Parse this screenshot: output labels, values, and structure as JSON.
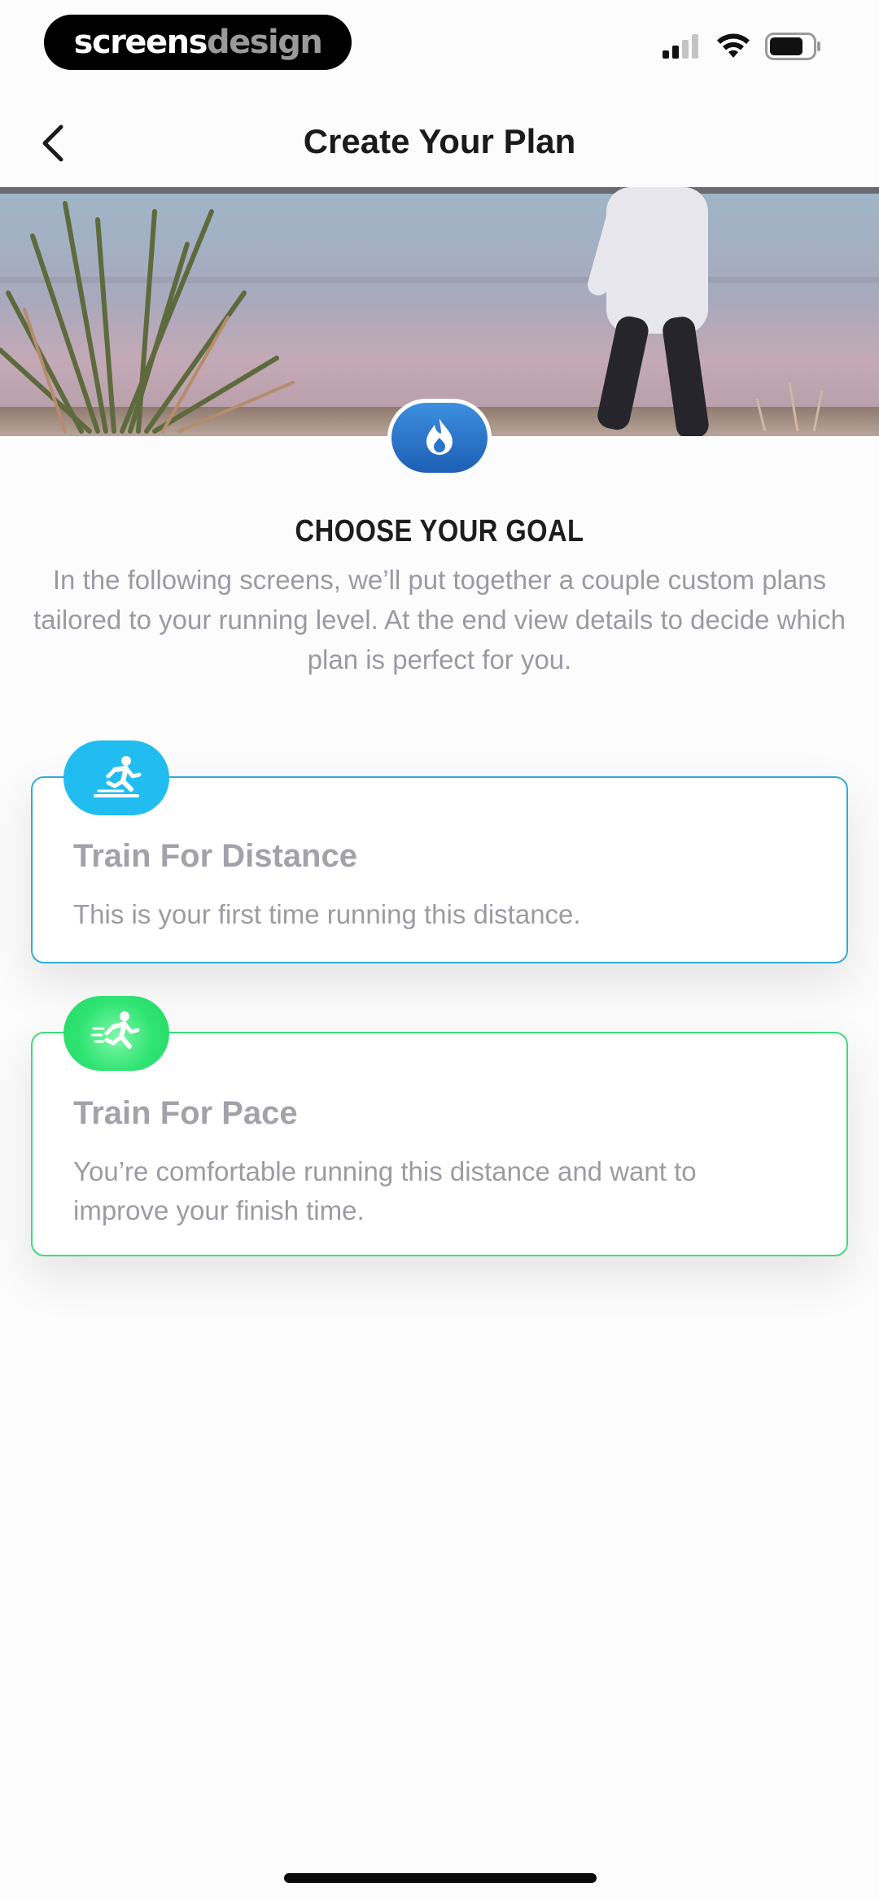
{
  "status_bar": {
    "brand_part1": "screens",
    "brand_part2": "design",
    "signal_icon": "cellular-signal-icon",
    "wifi_icon": "wifi-icon",
    "battery_icon": "battery-icon"
  },
  "nav": {
    "back_icon": "chevron-left-icon",
    "title": "Create Your Plan"
  },
  "hero": {
    "badge_icon": "flame-icon"
  },
  "goal": {
    "heading": "CHOOSE YOUR GOAL",
    "description": "In the following screens, we’ll put together a couple custom plans tailored to your running level. At the end view details to decide which plan is perfect for you."
  },
  "options": [
    {
      "icon": "runner-finish-line-icon",
      "title": "Train For Distance",
      "description": "This is your first time running this distance.",
      "accent": "#35a9d9"
    },
    {
      "icon": "runner-speed-icon",
      "title": "Train For Pace",
      "description": "You’re comfortable running this distance and want to improve your finish time.",
      "accent": "#3ddc7a"
    }
  ],
  "colors": {
    "blue_accent": "#22bdf0",
    "green_accent": "#2fe472",
    "flame_badge": "#2a76cc"
  }
}
